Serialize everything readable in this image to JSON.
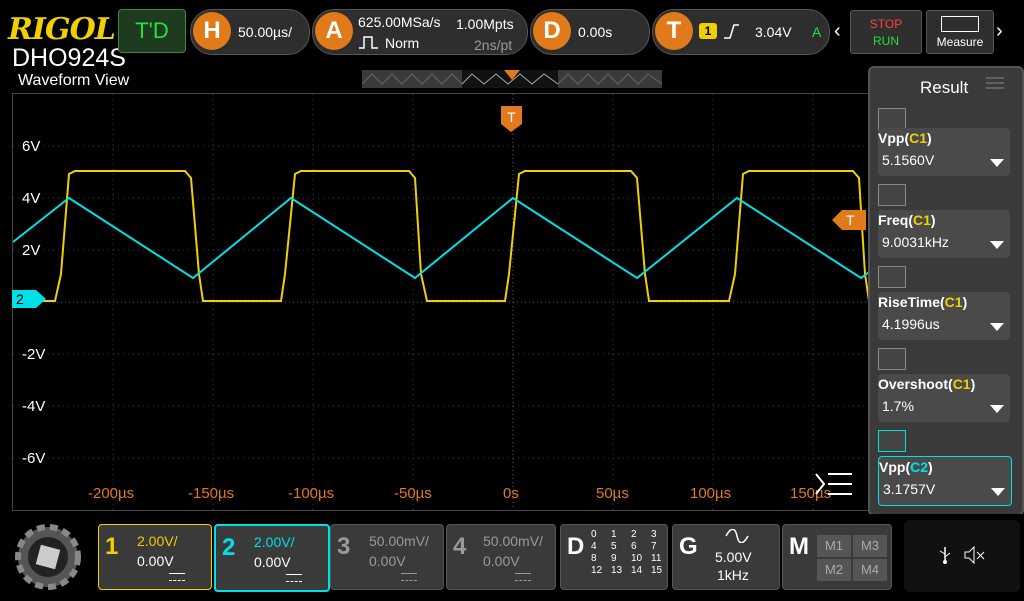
{
  "brand": {
    "logo": "RIGOL",
    "model": "DHO924S"
  },
  "top": {
    "td_label": "T'D",
    "horizontal": {
      "icon": "H",
      "timebase": "50.00µs/"
    },
    "acquire": {
      "icon": "A",
      "sample_rate": "625.00MSa/s",
      "memory": "1.00Mpts",
      "mode": "Norm",
      "resolution": "2ns/pt"
    },
    "delay": {
      "icon": "D",
      "value": "0.00s"
    },
    "trigger": {
      "icon": "T",
      "source": "1",
      "level": "3.04V",
      "mode": "A"
    },
    "stop_label": "STOP",
    "run_label": "RUN",
    "measure_label": "Measure"
  },
  "view": {
    "title": "Waveform View",
    "trigger_marker": "T",
    "y_labels": [
      "6V",
      "4V",
      "2V",
      "-2V",
      "-4V",
      "-6V"
    ],
    "x_labels": [
      "-200µs",
      "-150µs",
      "-100µs",
      "-50µs",
      "0s",
      "50µs",
      "100µs",
      "150µs"
    ],
    "ch2_marker": "2",
    "trig_level_marker": "T"
  },
  "result": {
    "title": "Result",
    "items": [
      {
        "name": "Vpp",
        "src": "C1",
        "value": "5.1560V",
        "src_color": "#f0d000"
      },
      {
        "name": "Freq",
        "src": "C1",
        "value": "9.0031kHz",
        "src_color": "#f0d000"
      },
      {
        "name": "RiseTime",
        "src": "C1",
        "value": "4.1996us",
        "src_color": "#f0d000"
      },
      {
        "name": "Overshoot",
        "src": "C1",
        "value": "1.7%",
        "src_color": "#f0d000"
      },
      {
        "name": "Vpp",
        "src": "C2",
        "value": "3.1757V",
        "src_color": "#00e0e8"
      }
    ]
  },
  "channels": [
    {
      "num": "1",
      "scale": "2.00V/",
      "offset": "0.00V",
      "color": "#f0d000"
    },
    {
      "num": "2",
      "scale": "2.00V/",
      "offset": "0.00V",
      "color": "#00e0e8"
    },
    {
      "num": "3",
      "scale": "50.00mV/",
      "offset": "0.00V",
      "color": "#9a9a9a"
    },
    {
      "num": "4",
      "scale": "50.00mV/",
      "offset": "0.00V",
      "color": "#9a9a9a"
    }
  ],
  "digital": {
    "label": "D",
    "rows": [
      [
        "0",
        "1",
        "2",
        "3"
      ],
      [
        "4",
        "5",
        "6",
        "7"
      ],
      [
        "8",
        "9",
        "10",
        "11"
      ],
      [
        "12",
        "13",
        "14",
        "15"
      ]
    ]
  },
  "generator": {
    "label": "G",
    "amplitude": "5.00V",
    "frequency": "1kHz"
  },
  "math": {
    "label": "M",
    "items": [
      "M1",
      "M3",
      "M2",
      "M4"
    ]
  },
  "colors": {
    "ch1": "#f0d000",
    "ch2": "#00e0e8",
    "accent": "#e07a1a"
  }
}
